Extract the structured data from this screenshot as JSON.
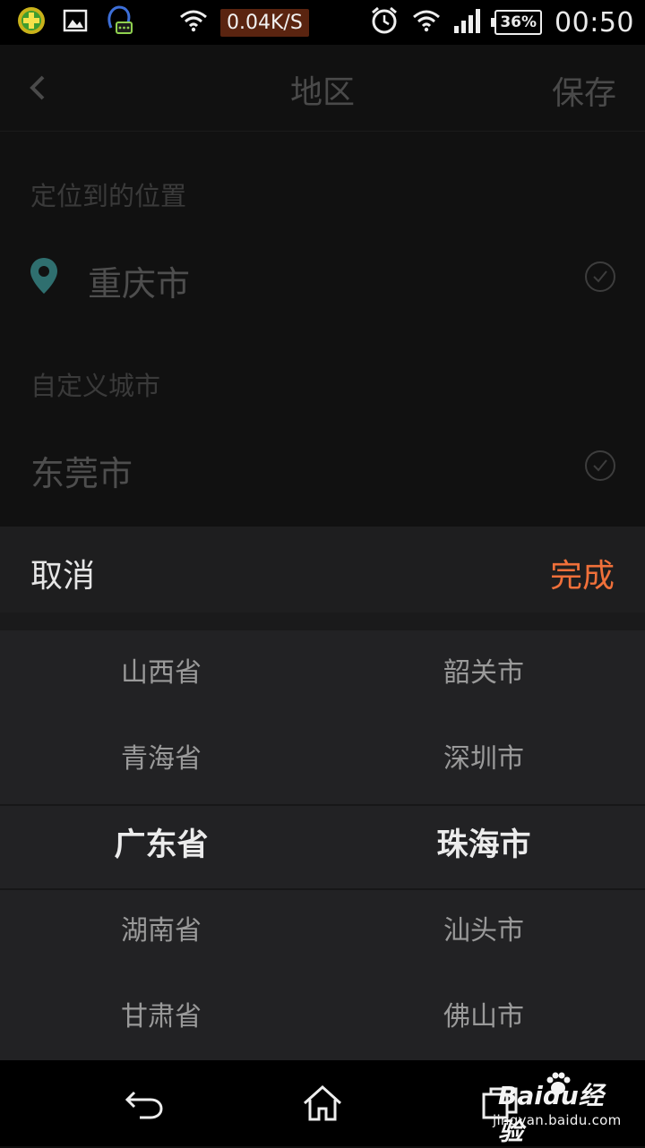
{
  "status_bar": {
    "net_speed": "0.04K/S",
    "battery": "36%",
    "time": "00:50"
  },
  "header": {
    "title": "地区",
    "save_label": "保存"
  },
  "located": {
    "section_label": "定位到的位置",
    "city": "重庆市"
  },
  "custom": {
    "section_label": "自定义城市",
    "city": "东莞市"
  },
  "picker": {
    "cancel_label": "取消",
    "done_label": "完成",
    "provinces": [
      "山西省",
      "青海省",
      "广东省",
      "湖南省",
      "甘肃省"
    ],
    "cities": [
      "韶关市",
      "深圳市",
      "珠海市",
      "汕头市",
      "佛山市"
    ],
    "selected_index": 2
  },
  "watermark": {
    "brand": "Baidu经验",
    "url": "jingyan.baidu.com"
  },
  "colors": {
    "accent": "#f0703a",
    "pin": "#2f6f6f"
  }
}
